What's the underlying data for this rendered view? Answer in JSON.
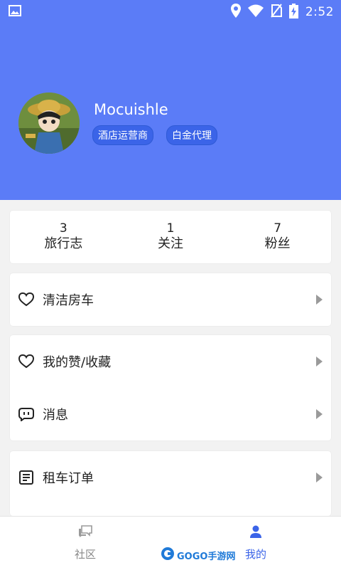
{
  "status_bar": {
    "time": "2:52",
    "icons": [
      "image-icon",
      "location-icon",
      "wifi-icon",
      "no-sim-icon",
      "battery-charging-icon"
    ]
  },
  "profile": {
    "username": "Mocuishle",
    "tags": [
      "酒店运营商",
      "白金代理"
    ],
    "avatar_icon": "avatar-icon"
  },
  "stats": [
    {
      "value": "3",
      "label": "旅行志"
    },
    {
      "value": "1",
      "label": "关注"
    },
    {
      "value": "7",
      "label": "粉丝"
    }
  ],
  "menu": {
    "group1": [
      {
        "label": "清洁房车",
        "icon": "heart-icon"
      }
    ],
    "group2": [
      {
        "label": "我的赞/收藏",
        "icon": "heart-icon"
      },
      {
        "label": "消息",
        "icon": "message-icon"
      }
    ],
    "group3": [
      {
        "label": "租车订单",
        "icon": "order-icon"
      }
    ]
  },
  "bottom_nav": {
    "items": [
      {
        "label": "社区",
        "icon": "community-icon",
        "active": false
      },
      {
        "label": "我的",
        "icon": "user-icon",
        "active": true
      }
    ],
    "active_color": "#3b64e8",
    "inactive_color": "#888888"
  },
  "watermark": {
    "text": "GOGO手游网"
  },
  "colors": {
    "header": "#5b7cf7",
    "tag": "#3b64e8"
  }
}
